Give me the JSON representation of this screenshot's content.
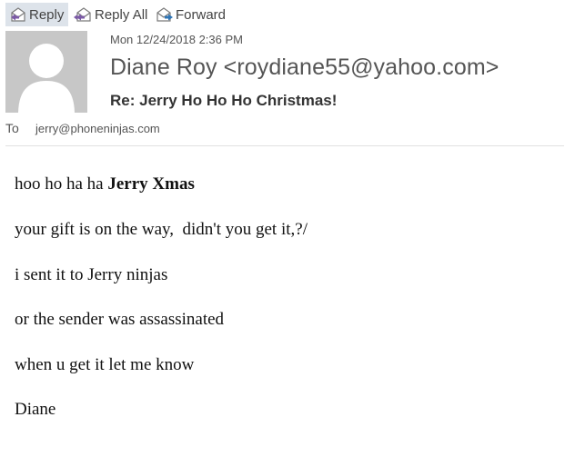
{
  "toolbar": {
    "reply_label": "Reply",
    "reply_all_label": "Reply All",
    "forward_label": "Forward",
    "reply_icon": "reply-icon",
    "reply_all_icon": "reply-all-icon",
    "forward_icon": "forward-icon"
  },
  "header": {
    "avatar_icon": "person-icon",
    "date": "Mon 12/24/2018 2:36 PM",
    "sender": "Diane Roy <roydiane55@yahoo.com>",
    "subject": "Re: Jerry Ho Ho Ho Christmas!",
    "to_label": "To",
    "to_address": "jerry@phoneninjas.com"
  },
  "body": {
    "line1_plain": "hoo ho ha ha ",
    "line1_bold": "Jerry Xmas",
    "line2": "your gift is on the way,  didn't you get it,?/",
    "line3": "i sent it to Jerry ninjas",
    "line4": "or the sender was assassinated",
    "line5": "when u get it let me know",
    "signature": "Diane"
  },
  "colors": {
    "active_button_bg": "#dde3ea",
    "avatar_bg": "#c7c7c7",
    "icon_purple": "#7b5aa6",
    "icon_blue": "#2e75b6"
  }
}
